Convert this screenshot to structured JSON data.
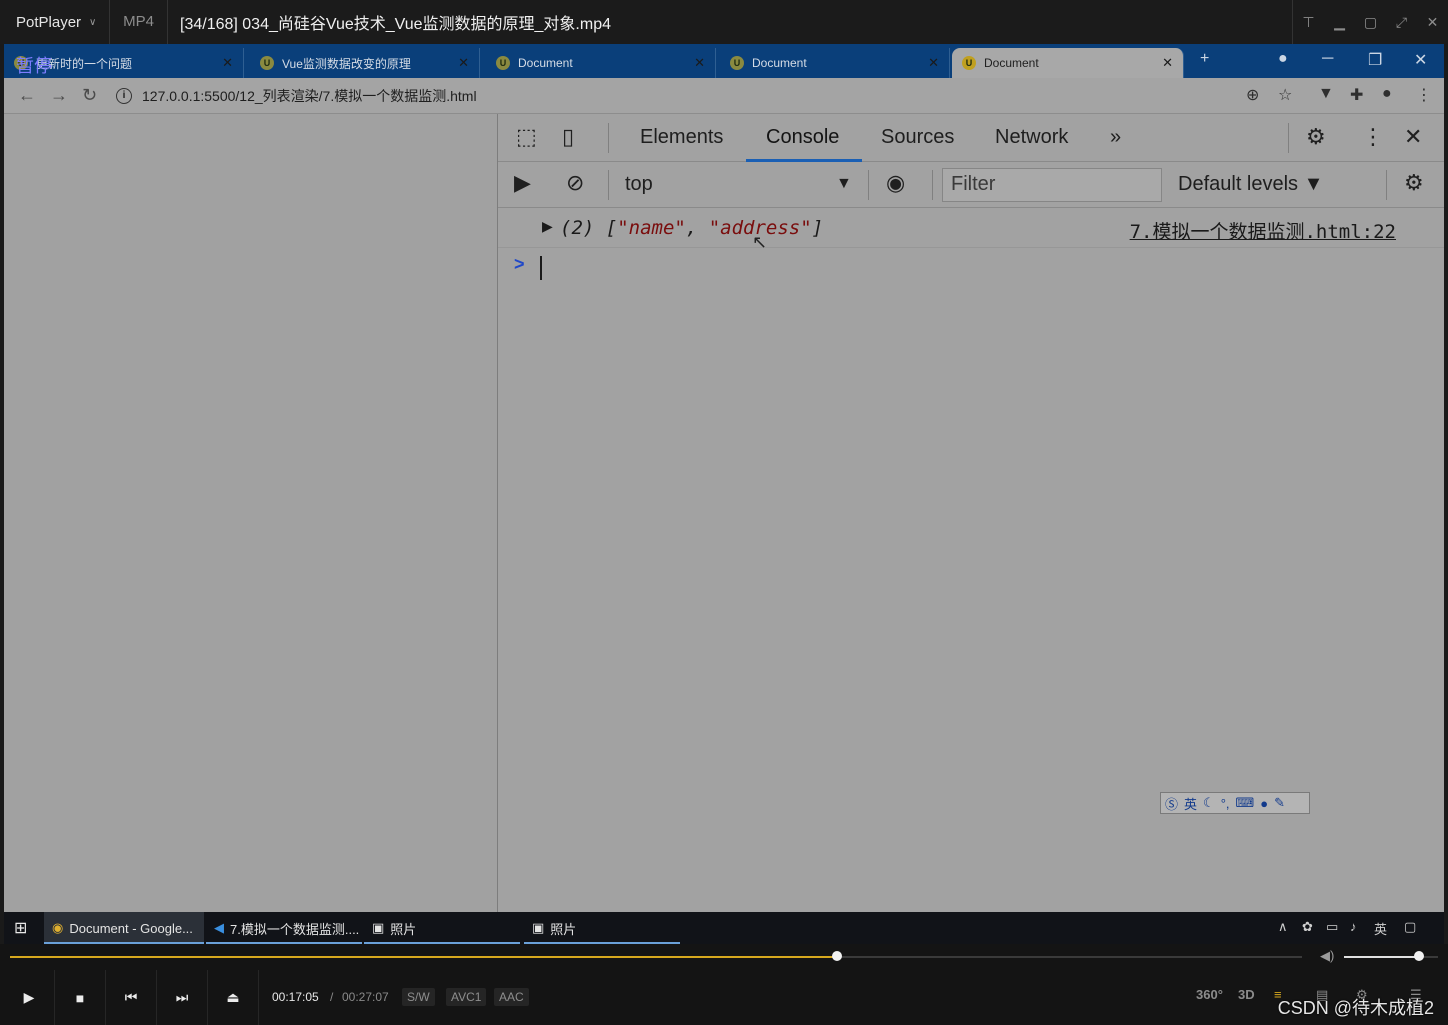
{
  "potplayer": {
    "brand": "PotPlayer",
    "format": "MP4",
    "file_title": "[34/168] 034_尚硅谷Vue技术_Vue监测数据的原理_对象.mp4",
    "pause_label": "暂停",
    "current_time": "00:17:05",
    "separator": "/",
    "total_time": "00:27:07",
    "badges": [
      "S/W",
      "AVC1",
      "AAC"
    ],
    "right_controls": [
      "360°",
      "3D"
    ],
    "progress": 0.64,
    "volume": 0.8
  },
  "browser": {
    "tabs": [
      {
        "label": "更新时的一个问题",
        "active": false
      },
      {
        "label": "Vue监测数据改变的原理",
        "active": false
      },
      {
        "label": "Document",
        "active": false
      },
      {
        "label": "Document",
        "active": false
      },
      {
        "label": "Document",
        "active": true
      }
    ],
    "new_tab": "+",
    "url": "127.0.0.1:5500/12_列表渲染/7.模拟一个数据监测.html"
  },
  "devtools": {
    "tabs": [
      "Elements",
      "Console",
      "Sources",
      "Network"
    ],
    "active_tab": "Console",
    "more": "»",
    "context": "top",
    "filter_placeholder": "Filter",
    "levels": "Default levels ▼",
    "log": {
      "prefix": "(2) [",
      "item1": "\"name\"",
      "comma": ", ",
      "item2": "\"address\"",
      "suffix": "]",
      "source": "7.模拟一个数据监测.html:22"
    },
    "prompt": ">"
  },
  "ime": {
    "lang": "英"
  },
  "taskbar": {
    "items": [
      {
        "label": "Document - Google..."
      },
      {
        "label": "7.模拟一个数据监测...."
      },
      {
        "label": "照片"
      },
      {
        "label": "照片"
      }
    ],
    "tray_lang": "英"
  },
  "watermark": "CSDN @待木成植2"
}
